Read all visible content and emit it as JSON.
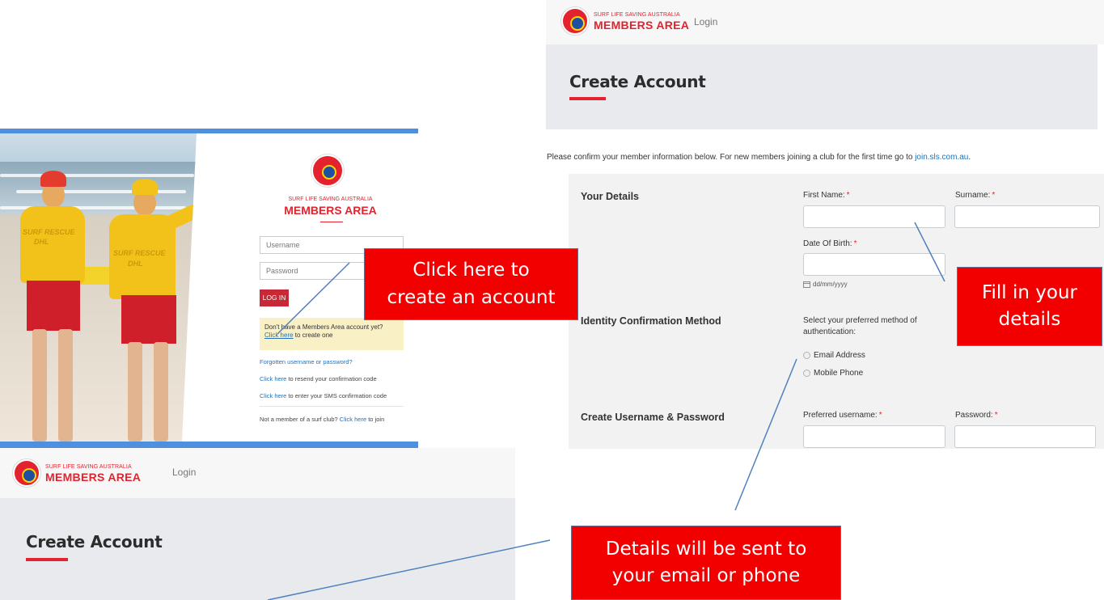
{
  "brand": {
    "small": "SURF LIFE SAVING AUSTRALIA",
    "big": "MEMBERS AREA",
    "badge_icon": "surf-life-saving-badge-icon"
  },
  "nav": {
    "login": "Login"
  },
  "create_account": {
    "title": "Create Account",
    "intro_text": "Please confirm your member information below. For new members joining a club for the first time go to ",
    "intro_link": "join.sls.com.au",
    "intro_end": ".",
    "sections": {
      "your_details": "Your Details",
      "identity": "Identity Confirmation Method",
      "credentials": "Create Username & Password"
    },
    "fields": {
      "first_name": "First Name:",
      "surname": "Surname:",
      "dob": "Date Of Birth:",
      "dob_hint": "dd/mm/yyyy",
      "auth_prompt_1": "Select your preferred method of",
      "auth_prompt_2": "authentication:",
      "email_option": "Email Address",
      "mobile_option": "Mobile Phone",
      "username": "Preferred username:",
      "password": "Password:",
      "required_mark": "*"
    }
  },
  "login_page": {
    "username_placeholder": "Username",
    "password_placeholder": "Password",
    "login_button": "LOG IN",
    "note_line1": "Don't have a Members Area account yet?",
    "note_link": "Click here",
    "note_line2": " to create one",
    "forgot": "Forgotten username or password?",
    "resend_link": "Click here",
    "resend_text": " to resend your confirmation code",
    "sms_link": "Click here",
    "sms_text": " to enter your SMS confirmation code",
    "not_member": "Not a member of a surf club? ",
    "join_link": "Click here",
    "join_text": " to join",
    "shirt_text_1": "SURF RESCUE",
    "shirt_text_2": "DHL",
    "shirt_text_3": "SURF RESCUE",
    "shirt_text_4": "DHL"
  },
  "callouts": {
    "click_here": [
      "Click here to",
      "create an account"
    ],
    "fill_in": [
      "Fill in your",
      "details"
    ],
    "details_sent": [
      "Details will be sent to",
      "your email or phone"
    ]
  },
  "colors": {
    "brand_red": "#e4222e",
    "callout_red": "#f20000",
    "accent_blue": "#4e8fe0",
    "link_blue": "#2372b9"
  }
}
